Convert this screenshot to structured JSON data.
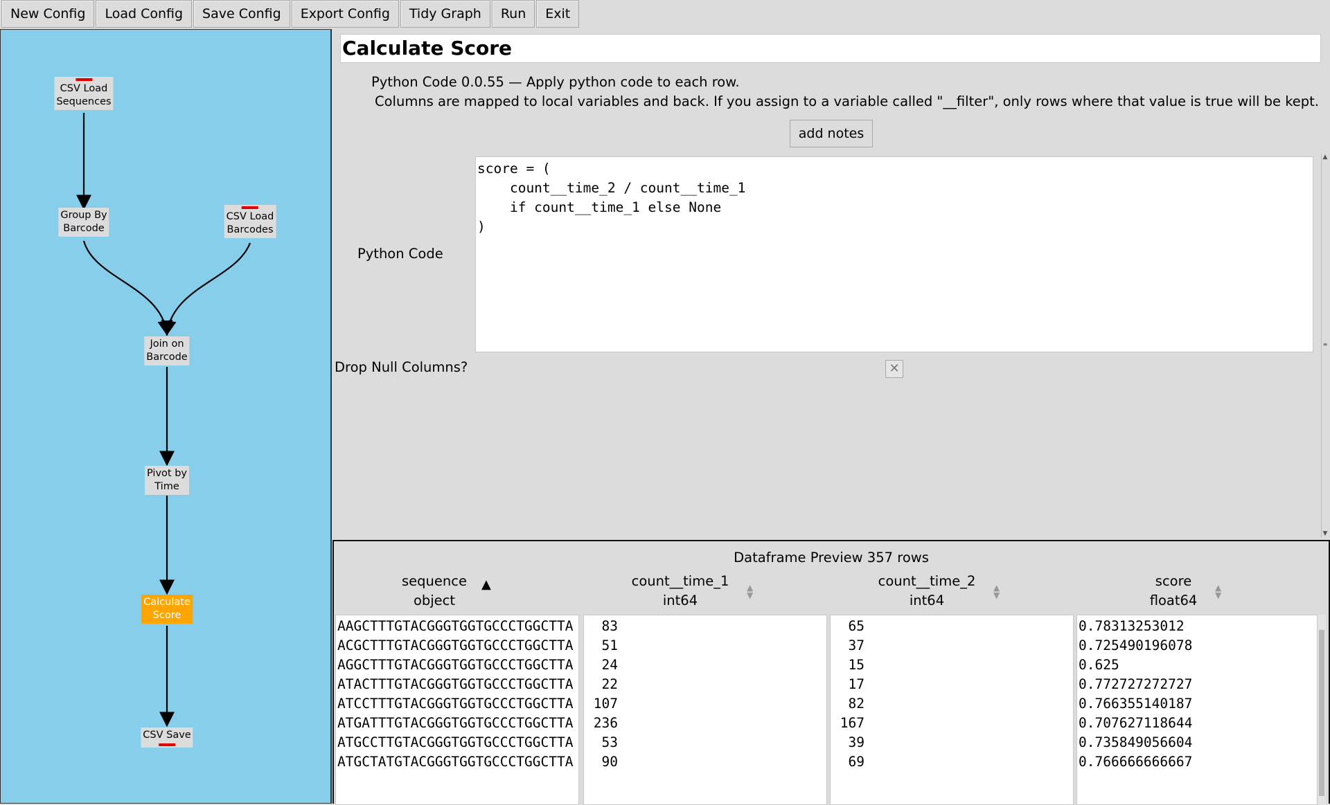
{
  "toolbar": {
    "buttons": [
      "New Config",
      "Load Config",
      "Save Config",
      "Export Config",
      "Tidy Graph",
      "Run",
      "Exit"
    ]
  },
  "graph": {
    "nodes": {
      "csv_load_sequences": "CSV Load\nSequences",
      "group_by_barcode": "Group By\nBarcode",
      "csv_load_barcodes": "CSV Load\nBarcodes",
      "join_on_barcode": "Join on\nBarcode",
      "pivot_by_time": "Pivot by\nTime",
      "calculate_score": "Calculate\nScore",
      "csv_save": "CSV Save"
    },
    "colors": {
      "background": "#87ceeb",
      "active_node": "#ffa500",
      "port_mark": "#e00000"
    }
  },
  "config": {
    "title": "Calculate Score",
    "description": "Python Code 0.0.55 — Apply python code to each row.",
    "description_detail": "Columns are mapped to local variables and back. If you assign to a variable called \"__filter\", only rows where that value is true will be kept.",
    "add_notes_label": "add notes",
    "code_label": "Python Code",
    "code_value": "score = (\n    count__time_2 / count__time_1\n    if count__time_1 else None\n)",
    "drop_null_label": "Drop Null Columns?",
    "drop_null_checked": false
  },
  "preview": {
    "title": "Dataframe Preview 357 rows",
    "columns": [
      {
        "name": "sequence",
        "dtype": "object",
        "sort": "ascending"
      },
      {
        "name": "count__time_1",
        "dtype": "int64",
        "sort": "none"
      },
      {
        "name": "count__time_2",
        "dtype": "int64",
        "sort": "none"
      },
      {
        "name": "score",
        "dtype": "float64",
        "sort": "none"
      }
    ],
    "rows": [
      [
        "AAGCTTTGTACGGGTGGTGCCCTGGCTTA",
        "  83",
        "  65",
        "0.78313253012"
      ],
      [
        "ACGCTTTGTACGGGTGGTGCCCTGGCTTA",
        "  51",
        "  37",
        "0.725490196078"
      ],
      [
        "AGGCTTTGTACGGGTGGTGCCCTGGCTTA",
        "  24",
        "  15",
        "0.625"
      ],
      [
        "ATACTTTGTACGGGTGGTGCCCTGGCTTA",
        "  22",
        "  17",
        "0.772727272727"
      ],
      [
        "ATCCTTTGTACGGGTGGTGCCCTGGCTTA",
        " 107",
        "  82",
        "0.766355140187"
      ],
      [
        "ATGATTTGTACGGGTGGTGCCCTGGCTTA",
        " 236",
        " 167",
        "0.707627118644"
      ],
      [
        "ATGCCTTGTACGGGTGGTGCCCTGGCTTA",
        "  53",
        "  39",
        "0.735849056604"
      ],
      [
        "ATGCTATGTACGGGTGGTGCCCTGGCTTA",
        "  90",
        "  69",
        "0.766666666667"
      ]
    ]
  }
}
